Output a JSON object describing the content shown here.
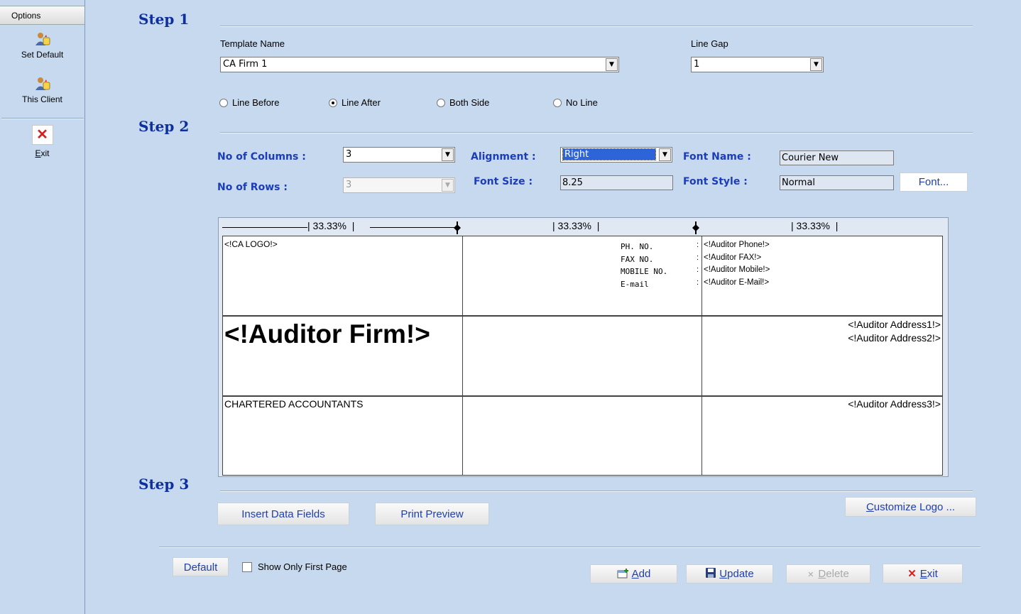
{
  "sidebar": {
    "header": "Options",
    "items": [
      {
        "label": "Set Default",
        "icon": "user-cursor-icon"
      },
      {
        "label": "This Client",
        "icon": "user-cursor-icon"
      },
      {
        "label": "Exit",
        "icon": "close-icon"
      }
    ]
  },
  "step1": {
    "title": "Step 1",
    "template_name_label": "Template Name",
    "template_name_value": "CA Firm 1",
    "line_gap_label": "Line Gap",
    "line_gap_value": "1",
    "line_options": [
      {
        "label": "Line Before",
        "selected": false
      },
      {
        "label": "Line After",
        "selected": true
      },
      {
        "label": "Both Side",
        "selected": false
      },
      {
        "label": "No Line",
        "selected": false
      }
    ]
  },
  "step2": {
    "title": "Step 2",
    "columns_label": "No of Columns :",
    "columns_value": "3",
    "rows_label": "No of Rows :",
    "rows_value": "3",
    "alignment_label": "Alignment  :",
    "alignment_value": "Right",
    "font_size_label": "Font Size :",
    "font_size_value": "8.25",
    "font_name_label": "Font Name :",
    "font_name_value": "Courier New",
    "font_style_label": "Font Style :",
    "font_style_value": "Normal",
    "font_button": "Font..."
  },
  "preview": {
    "column_widths": [
      "| 33.33%  |",
      "| 33.33%  |",
      "| 33.33%  |"
    ],
    "cells": {
      "r1c1": "<!CA LOGO!>",
      "r1c2_labels": [
        "PH. NO.",
        "FAX NO.",
        "MOBILE NO.",
        "E-mail"
      ],
      "r1c3_values": [
        "<!Auditor Phone!>",
        "<!Auditor FAX!>",
        "<!Auditor Mobile!>",
        "<!Auditor E-Mail!>"
      ],
      "r2c1": "<!Auditor Firm!>",
      "r2c3": [
        "<!Auditor Address1!>",
        "<!Auditor Address2!>"
      ],
      "r3c1": "CHARTERED ACCOUNTANTS",
      "r3c3": "<!Auditor Address3!>"
    }
  },
  "step3": {
    "title": "Step 3",
    "insert_button": "Insert Data Fields",
    "print_preview_button": "Print Preview",
    "customize_logo_button": "Customize Logo ..."
  },
  "footer": {
    "default_button": "Default",
    "show_first_page_label": "Show Only First Page",
    "show_first_page_checked": false,
    "add_button": "Add",
    "update_button": "Update",
    "delete_button": "Delete",
    "exit_button": "Exit"
  }
}
